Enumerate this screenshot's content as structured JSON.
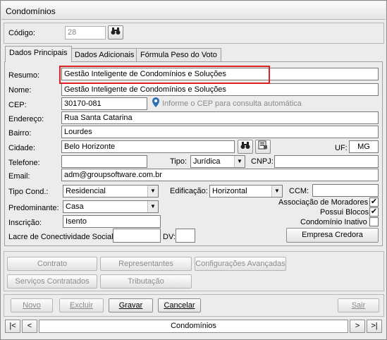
{
  "window": {
    "title": "Condomínios"
  },
  "codigo": {
    "label": "Código:",
    "value": "28"
  },
  "tabs": [
    {
      "label": "Dados Principais"
    },
    {
      "label": "Dados Adicionais"
    },
    {
      "label": "Fórmula Peso do Voto"
    }
  ],
  "form": {
    "resumo_label": "Resumo:",
    "resumo_value": "Gestão Inteligente de Condomínios e Soluções",
    "nome_label": "Nome:",
    "nome_value": "Gestão Inteligente de Condomínios e Soluções",
    "cep_label": "CEP:",
    "cep_value": "30170-081",
    "cep_hint": "Informe o CEP para consulta automática",
    "endereco_label": "Endereço:",
    "endereco_value": "Rua Santa Catarina",
    "bairro_label": "Bairro:",
    "bairro_value": "Lourdes",
    "cidade_label": "Cidade:",
    "cidade_value": "Belo Horizonte",
    "uf_label": "UF:",
    "uf_value": "MG",
    "telefone_label": "Telefone:",
    "telefone_value": "",
    "tipo_label": "Tipo:",
    "tipo_value": "Jurídica",
    "cnpj_label": "CNPJ:",
    "cnpj_value": "",
    "email_label": "Email:",
    "email_value": "adm@groupsoftware.com.br",
    "tipo_cond_label": "Tipo Cond.:",
    "tipo_cond_value": "Residencial",
    "edificacao_label": "Edificação:",
    "edificacao_value": "Horizontal",
    "ccm_label": "CCM:",
    "ccm_value": "",
    "predominante_label": "Predominante:",
    "predominante_value": "Casa",
    "inscricao_label": "Inscrição:",
    "inscricao_value": "Isento",
    "lacre_label": "Lacre de Conectividade Social:",
    "lacre_value": "",
    "dv_label": "DV:",
    "dv_value": "",
    "assoc_label": "Associação de Moradores",
    "assoc_checked": "✔",
    "blocos_label": "Possui Blocos",
    "blocos_checked": "✔",
    "inativo_label": "Condomínio Inativo",
    "inativo_checked": "",
    "empresa_credora": "Empresa Credora"
  },
  "actions": {
    "contrato": "Contrato",
    "representantes": "Representantes",
    "configuracoes": "Configurações Avançadas",
    "servicos": "Serviços Contratados",
    "tributacao": "Tributação"
  },
  "footer": {
    "novo": "Novo",
    "excluir": "Excluir",
    "gravar": "Gravar",
    "cancelar": "Cancelar",
    "sair": "Sair"
  },
  "nav": {
    "first": "|<",
    "prev": "<",
    "label": "Condomínios",
    "next": ">",
    "last": ">|"
  }
}
